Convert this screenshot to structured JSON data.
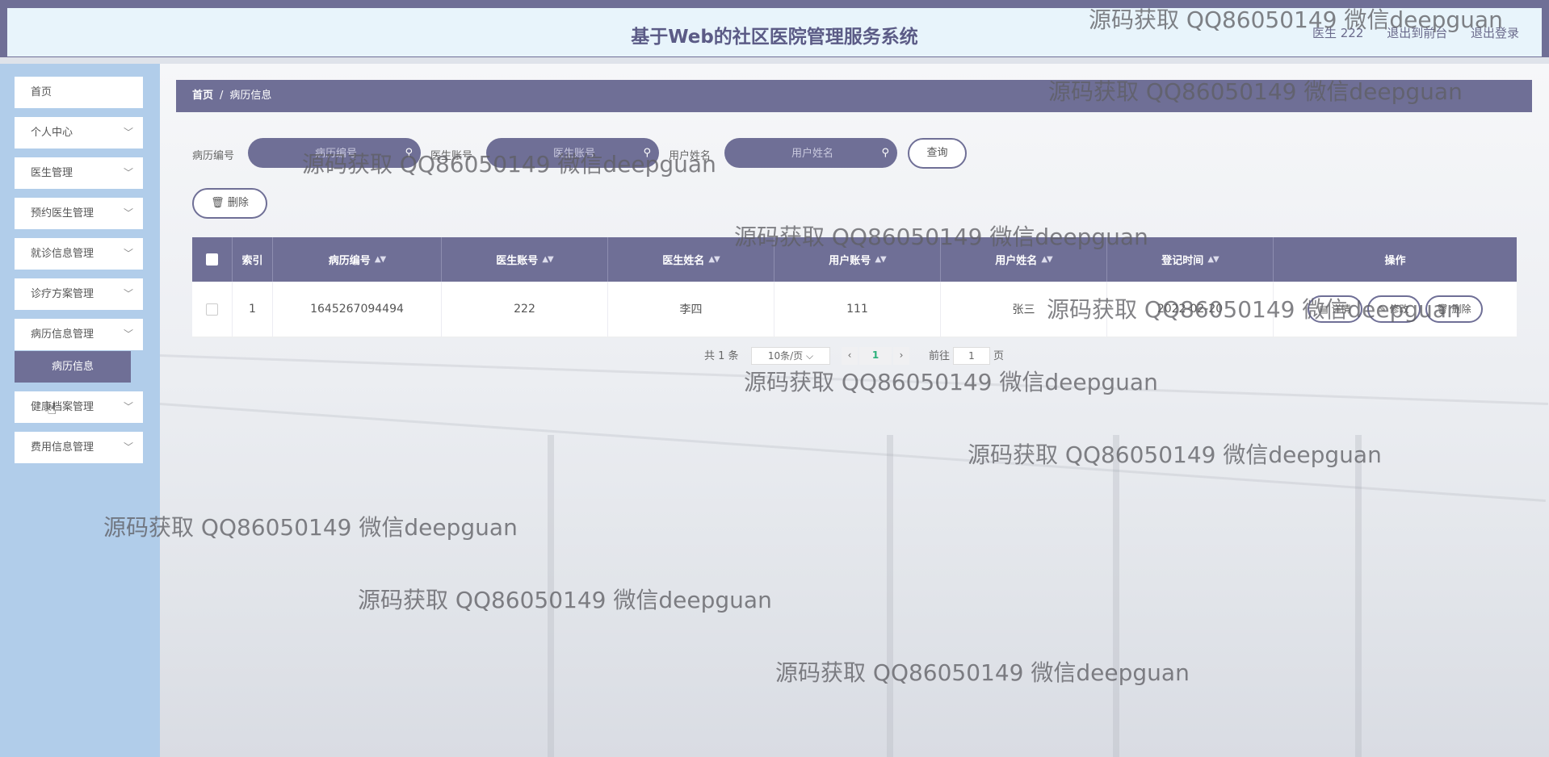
{
  "header": {
    "title": "基于Web的社区医院管理服务系统",
    "user": "医生 222",
    "front_link": "退出到前台",
    "logout_link": "退出登录"
  },
  "sidebar": {
    "items": [
      {
        "label": "首页"
      },
      {
        "label": "个人中心"
      },
      {
        "label": "医生管理"
      },
      {
        "label": "预约医生管理"
      },
      {
        "label": "就诊信息管理"
      },
      {
        "label": "诊疗方案管理"
      },
      {
        "label": "病历信息管理"
      },
      {
        "label": "健康档案管理"
      },
      {
        "label": "费用信息管理"
      }
    ],
    "active_sub": "病历信息"
  },
  "breadcrumb": {
    "home": "首页",
    "sep": "/",
    "current": "病历信息"
  },
  "filters": {
    "record_no_label": "病历编号",
    "record_no_placeholder": "病历编号",
    "doctor_acc_label": "医生账号",
    "doctor_acc_placeholder": "医生账号",
    "user_name_label": "用户姓名",
    "user_name_placeholder": "用户姓名",
    "query_button": "查询"
  },
  "actions": {
    "delete_button": "删除",
    "delete_icon": "trash-icon"
  },
  "table": {
    "headers": [
      "索引",
      "病历编号",
      "医生账号",
      "医生姓名",
      "用户账号",
      "用户姓名",
      "登记时间",
      "操作"
    ],
    "rows": [
      {
        "index": "1",
        "record_no": "1645267094494",
        "doctor_account": "222",
        "doctor_name": "李四",
        "user_account": "111",
        "user_name": "张三",
        "reg_time": "2022-02-20",
        "detail": "详情",
        "edit": "修改",
        "delete": "删除"
      }
    ]
  },
  "pagination": {
    "total": "共 1 条",
    "page_size": "10条/页",
    "current_page": "1",
    "goto_label": "前往",
    "goto_value": "1",
    "page_suffix": "页"
  },
  "watermark": "源码获取 QQ86050149 微信deepguan",
  "colors": {
    "primary": "#6f6f96",
    "sidebar": "#b1cdea",
    "header_bg": "#e8f4fb"
  }
}
